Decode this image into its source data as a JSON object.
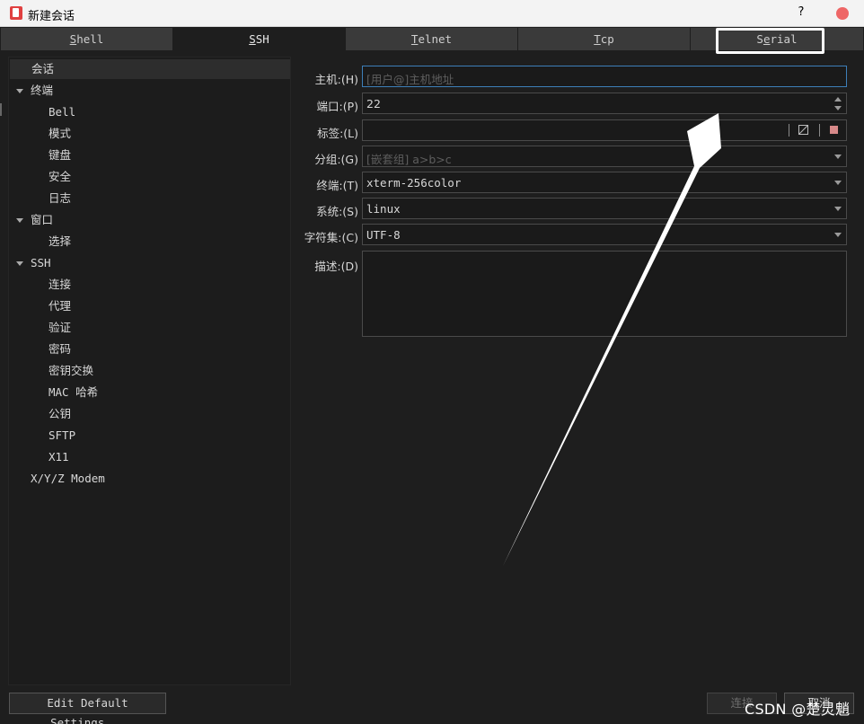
{
  "window": {
    "title": "新建会话",
    "help_label": "?"
  },
  "tabs": [
    {
      "pre": "",
      "u": "S",
      "post": "hell"
    },
    {
      "pre": "",
      "u": "S",
      "post": "SH"
    },
    {
      "pre": "",
      "u": "T",
      "post": "elnet"
    },
    {
      "pre": "",
      "u": "T",
      "post": "cp"
    },
    {
      "pre": "S",
      "u": "e",
      "post": "rial"
    }
  ],
  "tree": {
    "session": "会话",
    "terminal": "终端",
    "bell": "Bell",
    "mode": "模式",
    "keyboard": "键盘",
    "security": "安全",
    "log": "日志",
    "window": "窗口",
    "select": "选择",
    "ssh": "SSH",
    "connection": "连接",
    "proxy": "代理",
    "auth": "验证",
    "password": "密码",
    "kex": "密钥交换",
    "mac": "MAC 哈希",
    "pubkey": "公钥",
    "sftp": "SFTP",
    "x11": "X11",
    "modem": "X/Y/Z Modem"
  },
  "form": {
    "host_label": "主机:(H)",
    "host_placeholder": "[用户@]主机地址",
    "host_value": "",
    "port_label": "端口:(P)",
    "port_value": "22",
    "tag_label": "标签:(L)",
    "tag_value": "",
    "group_label": "分组:(G)",
    "group_placeholder": "[嵌套组] a>b>c",
    "terminal_label": "终端:(T)",
    "terminal_value": "xterm-256color",
    "system_label": "系统:(S)",
    "system_value": "linux",
    "charset_label": "字符集:(C)",
    "charset_value": "UTF-8",
    "desc_label": "描述:(D)",
    "desc_value": ""
  },
  "buttons": {
    "edit_default": "Edit Default Settings...",
    "connect": "连接",
    "cancel": "取消"
  },
  "watermark": "CSDN @楚灵魈",
  "colors": {
    "focus_border": "#3d7fb8",
    "tag_color": "#d88a8a",
    "close_button": "#e66666"
  }
}
